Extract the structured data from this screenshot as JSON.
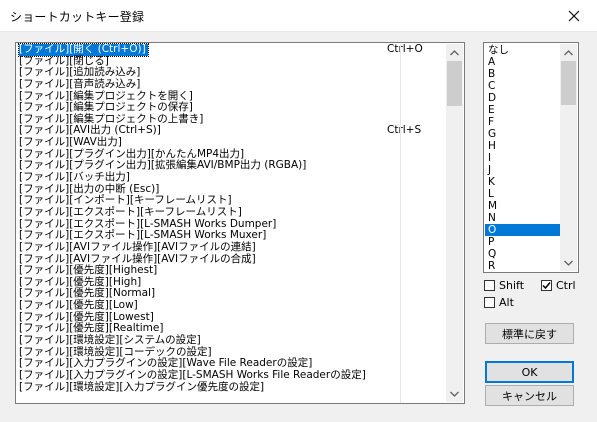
{
  "window": {
    "title": "ショートカットキー登録"
  },
  "main_list": {
    "items": [
      {
        "name": "[ファイル][開く (Ctrl+O)]",
        "key": "Ctrl+O",
        "selected": true
      },
      {
        "name": "[ファイル][閉じる]",
        "key": ""
      },
      {
        "name": "[ファイル][追加読み込み]",
        "key": ""
      },
      {
        "name": "[ファイル][音声読み込み]",
        "key": ""
      },
      {
        "name": "[ファイル][編集プロジェクトを開く]",
        "key": ""
      },
      {
        "name": "[ファイル][編集プロジェクトの保存]",
        "key": ""
      },
      {
        "name": "[ファイル][編集プロジェクトの上書き]",
        "key": ""
      },
      {
        "name": "[ファイル][AVI出力 (Ctrl+S)]",
        "key": "Ctrl+S"
      },
      {
        "name": "[ファイル][WAV出力]",
        "key": ""
      },
      {
        "name": "[ファイル][プラグイン出力][かんたんMP4出力]",
        "key": ""
      },
      {
        "name": "[ファイル][プラグイン出力][拡張編集AVI/BMP出力 (RGBA)]",
        "key": ""
      },
      {
        "name": "[ファイル][バッチ出力]",
        "key": ""
      },
      {
        "name": "[ファイル][出力の中断 (Esc)]",
        "key": ""
      },
      {
        "name": "[ファイル][インポート][キーフレームリスト]",
        "key": ""
      },
      {
        "name": "[ファイル][エクスポート][キーフレームリスト]",
        "key": ""
      },
      {
        "name": "[ファイル][エクスポート][L-SMASH Works Dumper]",
        "key": ""
      },
      {
        "name": "[ファイル][エクスポート][L-SMASH Works Muxer]",
        "key": ""
      },
      {
        "name": "[ファイル][AVIファイル操作][AVIファイルの連結]",
        "key": ""
      },
      {
        "name": "[ファイル][AVIファイル操作][AVIファイルの合成]",
        "key": ""
      },
      {
        "name": "[ファイル][優先度][Highest]",
        "key": ""
      },
      {
        "name": "[ファイル][優先度][High]",
        "key": ""
      },
      {
        "name": "[ファイル][優先度][Normal]",
        "key": ""
      },
      {
        "name": "[ファイル][優先度][Low]",
        "key": ""
      },
      {
        "name": "[ファイル][優先度][Lowest]",
        "key": ""
      },
      {
        "name": "[ファイル][優先度][Realtime]",
        "key": ""
      },
      {
        "name": "[ファイル][環境設定][システムの設定]",
        "key": ""
      },
      {
        "name": "[ファイル][環境設定][コーデックの設定]",
        "key": ""
      },
      {
        "name": "[ファイル][入力プラグインの設定][Wave File Readerの設定]",
        "key": ""
      },
      {
        "name": "[ファイル][入力プラグインの設定][L-SMASH Works File Readerの設定]",
        "key": ""
      },
      {
        "name": "[ファイル][環境設定][入力プラグイン優先度の設定]",
        "key": ""
      }
    ]
  },
  "key_list": {
    "items": [
      "なし",
      "A",
      "B",
      "C",
      "D",
      "E",
      "F",
      "G",
      "H",
      "I",
      "J",
      "K",
      "L",
      "M",
      "N",
      "O",
      "P",
      "Q",
      "R"
    ],
    "selected": "O"
  },
  "modifiers": {
    "shift": {
      "label": "Shift",
      "checked": false
    },
    "ctrl": {
      "label": "Ctrl",
      "checked": true
    },
    "alt": {
      "label": "Alt",
      "checked": false
    }
  },
  "buttons": {
    "reset": "標準に戻す",
    "ok": "OK",
    "cancel": "キャンセル"
  },
  "icons": {
    "close": "close-icon",
    "scroll_up": "chevron-up-icon",
    "scroll_down": "chevron-down-icon",
    "check": "checkmark-icon"
  },
  "colors": {
    "selection": "#0078d7",
    "window_bg": "#f0f0f0",
    "button_face": "#e1e1e1"
  }
}
